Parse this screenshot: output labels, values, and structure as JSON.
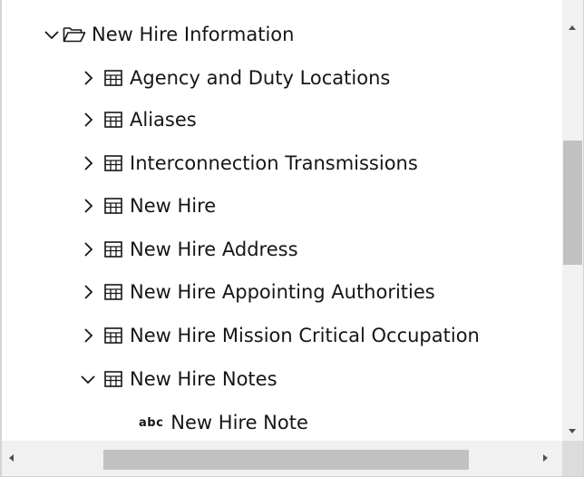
{
  "tree": {
    "root": {
      "label": "New Hire Information",
      "expanded": true,
      "icon": "folder-icon"
    },
    "tables": [
      {
        "label": "Agency and Duty Locations",
        "expanded": false,
        "icon": "table-icon"
      },
      {
        "label": "Aliases",
        "expanded": false,
        "icon": "table-icon"
      },
      {
        "label": "Interconnection Transmissions",
        "expanded": false,
        "icon": "table-icon"
      },
      {
        "label": "New Hire",
        "expanded": false,
        "icon": "table-icon"
      },
      {
        "label": "New Hire Address",
        "expanded": false,
        "icon": "table-icon"
      },
      {
        "label": "New Hire Appointing Authorities",
        "expanded": false,
        "icon": "table-icon"
      },
      {
        "label": "New Hire Mission Critical Occupation",
        "expanded": false,
        "icon": "table-icon"
      },
      {
        "label": "New Hire Notes",
        "expanded": true,
        "icon": "table-icon"
      }
    ],
    "fields": [
      {
        "type_badge": "abc",
        "label": "New Hire Note",
        "icon": "text-field-icon"
      }
    ]
  },
  "colors": {
    "text": "#161616",
    "scroll_track": "#f1f1f1",
    "scroll_thumb": "#c1c1c1"
  }
}
